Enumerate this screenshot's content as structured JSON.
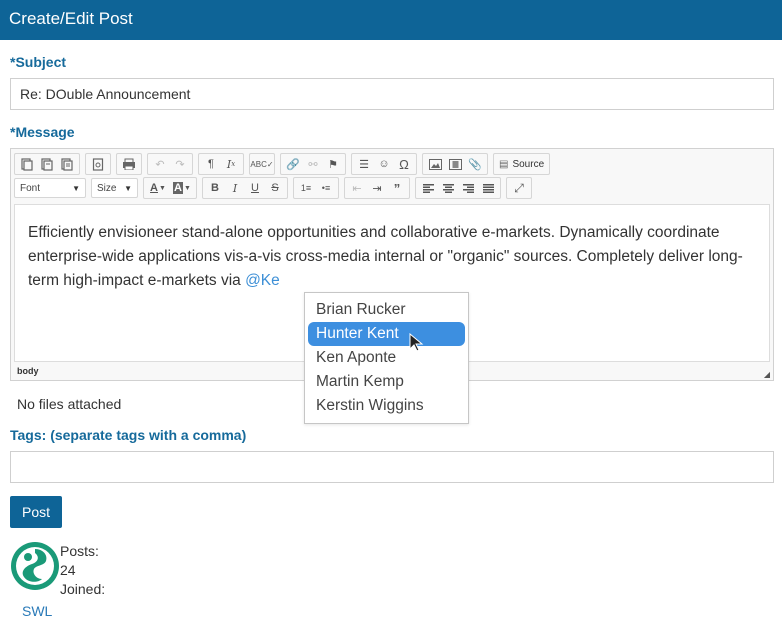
{
  "header": {
    "title": "Create/Edit Post"
  },
  "subject": {
    "label": "*Subject",
    "value": "Re: DOuble Announcement"
  },
  "message": {
    "label": "*Message",
    "toolbar": {
      "source_label": "Source",
      "font_label": "Font",
      "size_label": "Size"
    },
    "body_text": "Efficiently envisioneer stand-alone opportunities and collaborative e-markets. Dynamically coordinate enterprise-wide applications vis-a-vis cross-media internal or \"organic\" sources. Completely deliver long-term high-impact e-markets via ",
    "mention_text": "@Ke",
    "status_path": "body"
  },
  "mention_dropdown": {
    "items": [
      {
        "label": "Brian Rucker"
      },
      {
        "label": "Hunter Kent"
      },
      {
        "label": "Ken Aponte"
      },
      {
        "label": "Martin Kemp"
      },
      {
        "label": "Kerstin Wiggins"
      }
    ],
    "selected_index": 1
  },
  "attachments": {
    "text": "No files attached"
  },
  "tags": {
    "label": "Tags: (separate tags with a comma)",
    "value": ""
  },
  "post_button": {
    "label": "Post"
  },
  "author": {
    "posts_label": "Posts:",
    "posts_value": "24",
    "joined_label": "Joined:",
    "name": "SWL"
  },
  "colors": {
    "brand": "#0e6497",
    "label": "#166a9b",
    "selection": "#3d8fe0",
    "mention": "#3d8fd6"
  }
}
